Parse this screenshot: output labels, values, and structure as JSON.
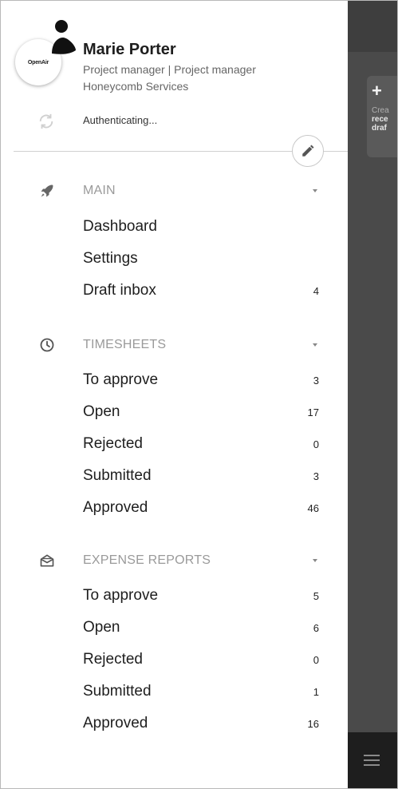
{
  "user": {
    "name": "Marie Porter",
    "role": "Project manager | Project manager",
    "company": "Honeycomb Services",
    "avatar_logo": "OpenAir",
    "status": "Authenticating..."
  },
  "sections": {
    "main": {
      "title": "MAIN",
      "items": [
        {
          "label": "Dashboard",
          "count": ""
        },
        {
          "label": "Settings",
          "count": ""
        },
        {
          "label": "Draft inbox",
          "count": "4"
        }
      ]
    },
    "timesheets": {
      "title": "TIMESHEETS",
      "items": [
        {
          "label": "To approve",
          "count": "3"
        },
        {
          "label": "Open",
          "count": "17"
        },
        {
          "label": "Rejected",
          "count": "0"
        },
        {
          "label": "Submitted",
          "count": "3"
        },
        {
          "label": "Approved",
          "count": "46"
        }
      ]
    },
    "expense_reports": {
      "title": "EXPENSE REPORTS",
      "items": [
        {
          "label": "To approve",
          "count": "5"
        },
        {
          "label": "Open",
          "count": "6"
        },
        {
          "label": "Rejected",
          "count": "0"
        },
        {
          "label": "Submitted",
          "count": "1"
        },
        {
          "label": "Approved",
          "count": "16"
        }
      ]
    }
  },
  "background": {
    "card_plus": "+",
    "card_line1": "Crea",
    "card_line2": "rece",
    "card_line3": "draf"
  },
  "icons": {
    "section_main": "rocket-icon",
    "section_timesheets": "clock-icon",
    "section_expenses": "envelope-open-icon",
    "sync": "sync-icon",
    "edit": "pencil-icon",
    "menu": "hamburger-icon"
  },
  "colors": {
    "drawer_bg": "#ffffff",
    "overlay_bg": "#4a4a4a",
    "section_title": "#9a9a9a",
    "text_primary": "#1e1e1e"
  }
}
